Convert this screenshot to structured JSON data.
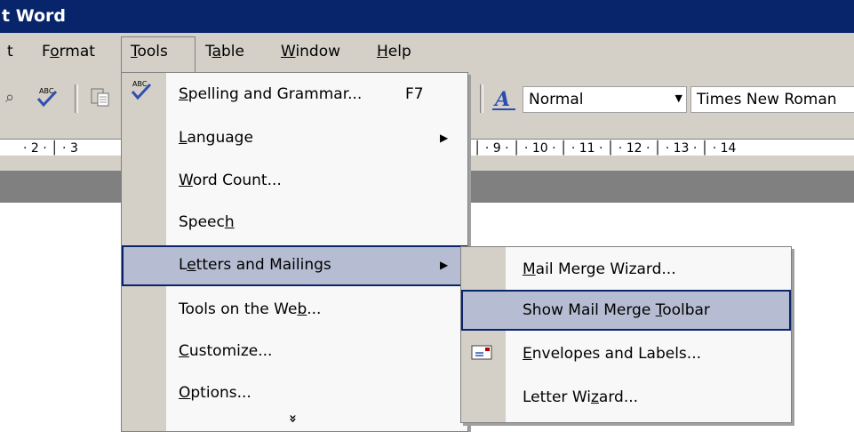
{
  "window": {
    "title": "t Word"
  },
  "menubar": {
    "items": [
      {
        "label": "t"
      },
      {
        "label": "Format"
      },
      {
        "label": "Tools"
      },
      {
        "label": "Table"
      },
      {
        "label": "Window"
      },
      {
        "label": "Help"
      }
    ]
  },
  "toolbar": {
    "style_value": "Normal",
    "font_value": "Times New Roman"
  },
  "ruler": {
    "left_text": "· 2 · │ · 3",
    "right_text": "│ · 9 · │ · 10 · │ · 11 · │ · 12 · │ · 13 · │ · 14"
  },
  "tools_menu": {
    "items": [
      {
        "label": "Spelling and Grammar...",
        "shortcut": "F7",
        "icon": "spelling-icon"
      },
      {
        "label": "Language",
        "submenu": true
      },
      {
        "label": "Word Count..."
      },
      {
        "label": "Speech"
      },
      {
        "label": "Letters and Mailings",
        "submenu": true,
        "highlighted": true
      },
      {
        "label": "Tools on the Web..."
      },
      {
        "label": "Customize..."
      },
      {
        "label": "Options..."
      }
    ],
    "expand_glyph": "»"
  },
  "letters_submenu": {
    "items": [
      {
        "label": "Mail Merge Wizard..."
      },
      {
        "label": "Show Mail Merge Toolbar",
        "highlighted": true
      },
      {
        "label": "Envelopes and Labels...",
        "icon": "envelope-icon"
      },
      {
        "label": "Letter Wizard..."
      }
    ]
  },
  "colors": {
    "titlebar": "#08246b",
    "highlight": "#b6bdd2",
    "highlight_border": "#0a246a",
    "chrome": "#d4d0c8"
  }
}
